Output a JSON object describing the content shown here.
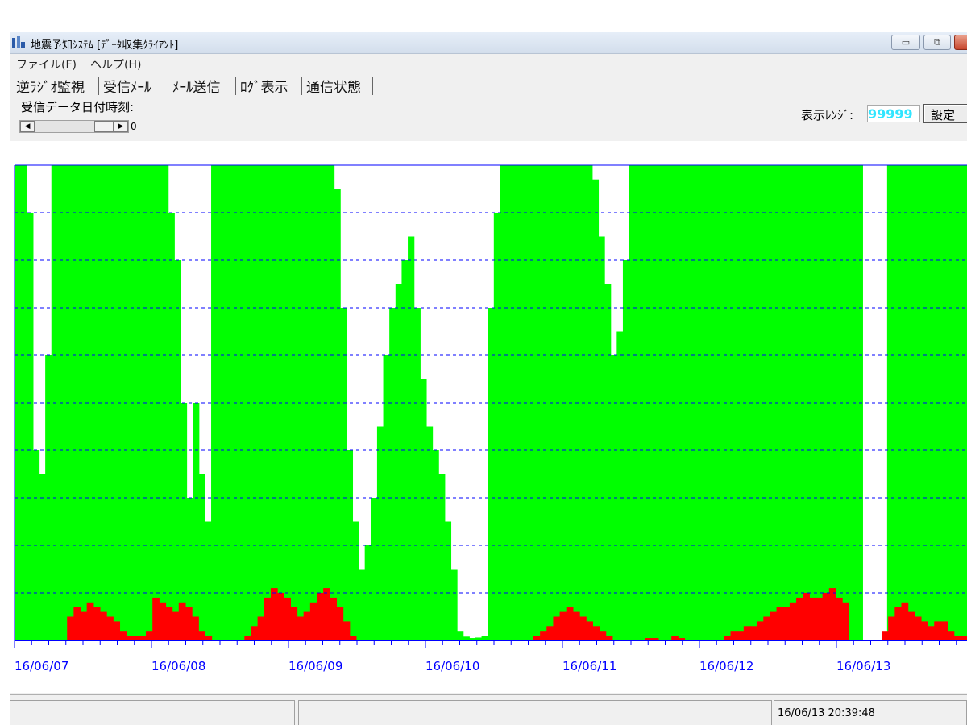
{
  "window": {
    "title": "地震予知ｼｽﾃﾑ [ﾃﾞｰﾀ収集ｸﾗｲｱﾝﾄ]",
    "min_label": "▭",
    "max_label": "⧉",
    "close_label": "✕"
  },
  "menu": {
    "file": "ファイル(F)",
    "help": "ヘルプ(H)"
  },
  "tabs": [
    "逆ﾗｼﾞｵ監視",
    "受信ﾒｰﾙ",
    "ﾒｰﾙ送信",
    "ﾛｸﾞ表示",
    "通信状態"
  ],
  "controls": {
    "recv_label": "受信データ日付時刻:",
    "scroll_value": "0",
    "range_label": "表示ﾚﾝｼﾞ:",
    "range_value": "99999",
    "set_button": "設定"
  },
  "status": {
    "timestamp": "16/06/13 20:39:48"
  },
  "colors": {
    "green": "#00ff00",
    "red": "#ff0000",
    "axis": "#0000ff"
  },
  "chart_data": {
    "type": "area",
    "x_labels": [
      "16/06/07",
      "16/06/08",
      "16/06/09",
      "16/06/10",
      "16/06/11",
      "16/06/12",
      "16/06/13"
    ],
    "ylim": [
      0,
      99999
    ],
    "grid": true,
    "series": [
      {
        "color": "#00ff00",
        "values": [
          99999,
          99999,
          90000,
          40000,
          35000,
          60000,
          99999,
          99999,
          99999,
          99999,
          99999,
          99999,
          99999,
          99999,
          99999,
          99999,
          99999,
          99999,
          99999,
          99999,
          99999,
          99999,
          99999,
          99999,
          99999,
          90000,
          80000,
          50000,
          30000,
          50000,
          35000,
          25000,
          99999,
          99999,
          99999,
          99999,
          99999,
          99999,
          99999,
          99999,
          99999,
          99999,
          99999,
          99999,
          99999,
          99999,
          99999,
          99999,
          99999,
          99999,
          99999,
          99999,
          95000,
          70000,
          40000,
          25000,
          15000,
          20000,
          30000,
          45000,
          60000,
          70000,
          75000,
          80000,
          85000,
          70000,
          55000,
          45000,
          40000,
          35000,
          25000,
          15000,
          2000,
          800,
          500,
          600,
          1000,
          70000,
          90000,
          99999,
          99999,
          99999,
          99999,
          99999,
          99999,
          99999,
          99999,
          99999,
          99999,
          99999,
          99999,
          99999,
          99999,
          99999,
          97000,
          85000,
          75000,
          60000,
          65000,
          80000,
          99999,
          99999,
          99999,
          99999,
          99999,
          99999,
          99999,
          99999,
          99999,
          99999,
          99999,
          99999,
          99999,
          99999,
          99999,
          99999,
          99999,
          99999,
          99999,
          99999,
          99999,
          99999,
          99999,
          99999,
          99999,
          99999,
          99999,
          99999,
          99999,
          99999,
          99999,
          99999,
          99999,
          99999,
          99999,
          99999,
          99999,
          99999,
          0,
          0,
          0,
          0,
          99999,
          99999,
          99999,
          99999,
          99999,
          99999,
          99999,
          99999,
          99999,
          99999,
          99999,
          99999,
          99999
        ]
      },
      {
        "color": "#ff0000",
        "values": [
          0,
          0,
          0,
          0,
          0,
          0,
          0,
          0,
          5000,
          7000,
          6000,
          8000,
          7000,
          6000,
          5000,
          4000,
          2000,
          1000,
          1000,
          1000,
          2000,
          9000,
          8000,
          7000,
          6000,
          8000,
          7000,
          5000,
          2000,
          1000,
          0,
          0,
          0,
          0,
          0,
          1000,
          3000,
          5000,
          9000,
          11000,
          10000,
          9000,
          7000,
          5000,
          6000,
          8000,
          10000,
          11000,
          9000,
          7000,
          4000,
          1000,
          0,
          0,
          0,
          0,
          0,
          0,
          0,
          0,
          0,
          0,
          0,
          0,
          0,
          0,
          0,
          0,
          0,
          0,
          0,
          0,
          0,
          0,
          0,
          0,
          0,
          0,
          0,
          1000,
          2000,
          3000,
          5000,
          6000,
          7000,
          6000,
          5000,
          4000,
          3000,
          2000,
          1000,
          0,
          0,
          0,
          0,
          0,
          500,
          500,
          0,
          0,
          1000,
          500,
          0,
          0,
          0,
          0,
          0,
          0,
          1000,
          2000,
          2000,
          3000,
          3000,
          4000,
          5000,
          6000,
          7000,
          7000,
          8000,
          9000,
          10000,
          9000,
          9000,
          10000,
          11000,
          9000,
          8000,
          0,
          0,
          0,
          0,
          0,
          2000,
          5000,
          7000,
          8000,
          6000,
          5000,
          4000,
          3000,
          4000,
          4000,
          2000,
          1000,
          1000
        ]
      }
    ]
  }
}
